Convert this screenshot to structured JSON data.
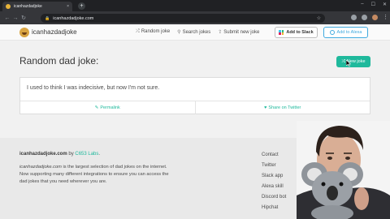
{
  "browser": {
    "tab_title": "icanhazdadjoke",
    "tab_close": "×",
    "new_tab": "+",
    "url": "icanhazdadjoke.com",
    "window_controls": [
      "–",
      "☐",
      "✕"
    ]
  },
  "site": {
    "brand": "icanhazdadjoke",
    "nav": [
      {
        "icon": "shuffle-icon",
        "label": "Random joke"
      },
      {
        "icon": "search-icon",
        "label": "Search jokes"
      },
      {
        "icon": "upload-icon",
        "label": "Submit new joke"
      }
    ],
    "slack_button": "Add to Slack",
    "alexa_button": "Add to Alexa"
  },
  "main": {
    "heading": "Random dad joke:",
    "new_joke_button": "New joke",
    "joke": "I used to think I was indecisive, but now I'm not sure.",
    "permalink": "Permalink",
    "share": "Share on Twitter"
  },
  "footer": {
    "brand": "icanhazdadjoke.com",
    "by": " by ",
    "author": "C653 Labs",
    "period": ".",
    "desc_brand": "icanhazdadjoke.com",
    "desc": " is the largest selection of dad jokes on the internet. Now supporting many different integrations to ensure you can access the dad jokes that you need wherever you are.",
    "links": [
      "Contact",
      "Twitter",
      "Slack app",
      "Alexa skill",
      "Discord bot",
      "Hipchat"
    ]
  },
  "colors": {
    "accent": "#1fb99c",
    "alexa": "#3fa9df",
    "chrome_dark": "#202124"
  }
}
